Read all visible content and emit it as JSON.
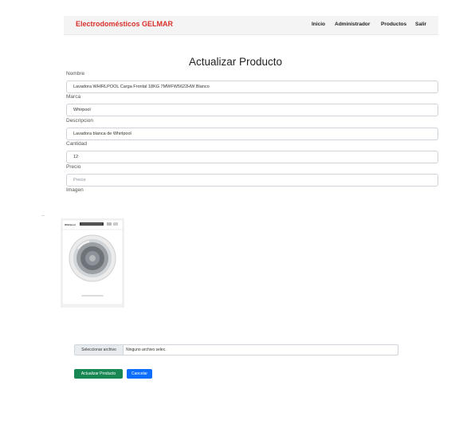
{
  "navbar": {
    "brand": "Electrodomésticos GELMAR",
    "links": [
      "Inicio",
      "Administrador",
      "Productos",
      "Salir"
    ]
  },
  "form": {
    "title": "Actualizar Producto",
    "fields": {
      "nombre": {
        "label": "Nombre",
        "value": "Lavadora WHIRLPOOL Carga Frontal 18KG 7MWFW5622HW Blanco"
      },
      "marca": {
        "label": "Marca",
        "value": "Whirpool"
      },
      "descripcion": {
        "label": "Descripcion",
        "value": "Lavadora blanca de Whirlpool"
      },
      "cantidad": {
        "label": "Cantidad",
        "value": "12"
      },
      "precio": {
        "label": "Precio",
        "value": "",
        "placeholder": "Precio"
      }
    },
    "imagen_label": "Imagen",
    "file": {
      "button": "Seleccionar archivo",
      "status": "Ninguno archivo selec."
    },
    "buttons": {
      "submit": "Actualizar Producto",
      "cancel": "Cancelar"
    }
  },
  "product_image": {
    "brand_text": "Whirlpool",
    "description": "washing-machine-icon"
  },
  "colors": {
    "brand": "#d9302b",
    "submit": "#198754",
    "cancel": "#0d6efd"
  }
}
